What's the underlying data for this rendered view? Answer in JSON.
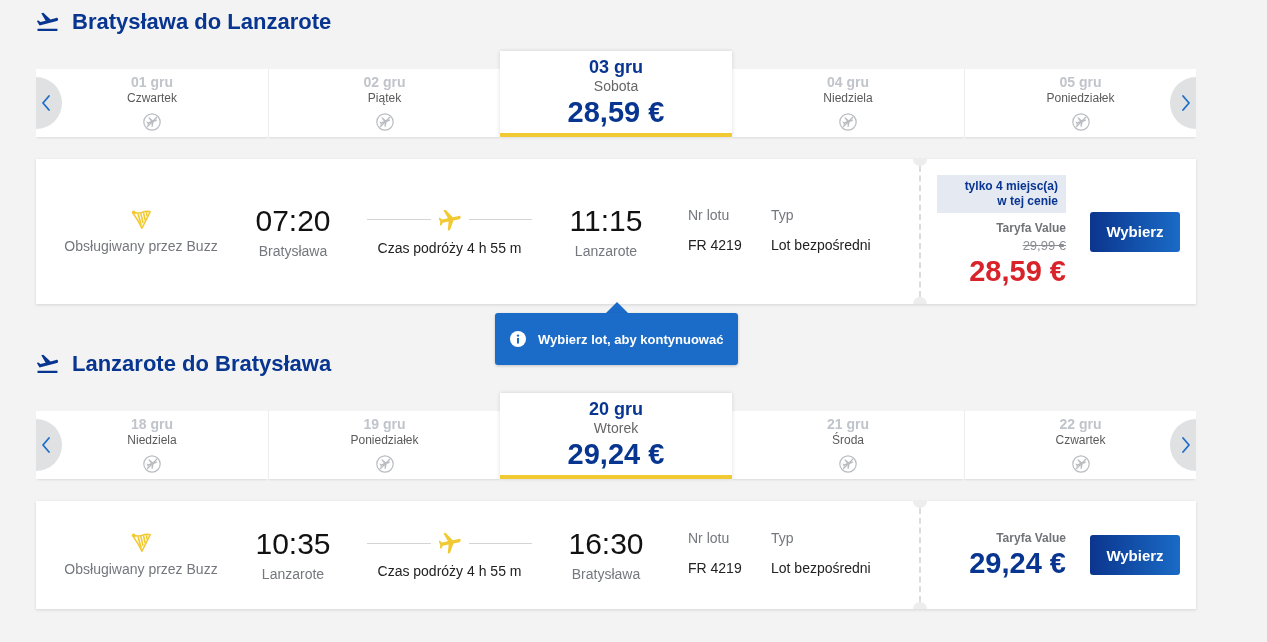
{
  "sections": [
    {
      "title": "Bratysława do Lanzarote",
      "dates": [
        {
          "date": "01 gru",
          "day": "Czwartek",
          "selected": false
        },
        {
          "date": "02 gru",
          "day": "Piątek",
          "selected": false
        },
        {
          "date": "03 gru",
          "day": "Sobota",
          "price": "28,59 €",
          "selected": true
        },
        {
          "date": "04 gru",
          "day": "Niedziela",
          "selected": false
        },
        {
          "date": "05 gru",
          "day": "Poniedziałek",
          "selected": false
        }
      ],
      "flight": {
        "operator": "Obsługiwany przez Buzz",
        "departure_time": "07:20",
        "departure_city": "Bratysława",
        "duration": "Czas podróży 4 h 55 m",
        "arrival_time": "11:15",
        "arrival_city": "Lanzarote",
        "flight_number_label": "Nr lotu",
        "flight_number": "FR 4219",
        "type_label": "Typ",
        "type": "Lot bezpośredni",
        "seats_badge": "tylko 4 miejsc(a)\nw tej cenie",
        "fare_label": "Taryfa Value",
        "old_price": "29,99 €",
        "price": "28,59 €",
        "button": "Wybierz"
      },
      "tooltip": {
        "text": "Wybierz lot, aby kontynuować"
      }
    },
    {
      "title": "Lanzarote do Bratysława",
      "dates": [
        {
          "date": "18 gru",
          "day": "Niedziela",
          "selected": false
        },
        {
          "date": "19 gru",
          "day": "Poniedziałek",
          "selected": false
        },
        {
          "date": "20 gru",
          "day": "Wtorek",
          "price": "29,24 €",
          "selected": true
        },
        {
          "date": "21 gru",
          "day": "Środa",
          "selected": false
        },
        {
          "date": "22 gru",
          "day": "Czwartek",
          "selected": false
        }
      ],
      "flight": {
        "operator": "Obsługiwany przez Buzz",
        "departure_time": "10:35",
        "departure_city": "Lanzarote",
        "duration": "Czas podróży 4 h 55 m",
        "arrival_time": "16:30",
        "arrival_city": "Bratysława",
        "flight_number_label": "Nr lotu",
        "flight_number": "FR 4219",
        "type_label": "Typ",
        "type": "Lot bezpośredni",
        "fare_label": "Taryfa Value",
        "price": "29,24 €",
        "button": "Wybierz"
      }
    }
  ]
}
